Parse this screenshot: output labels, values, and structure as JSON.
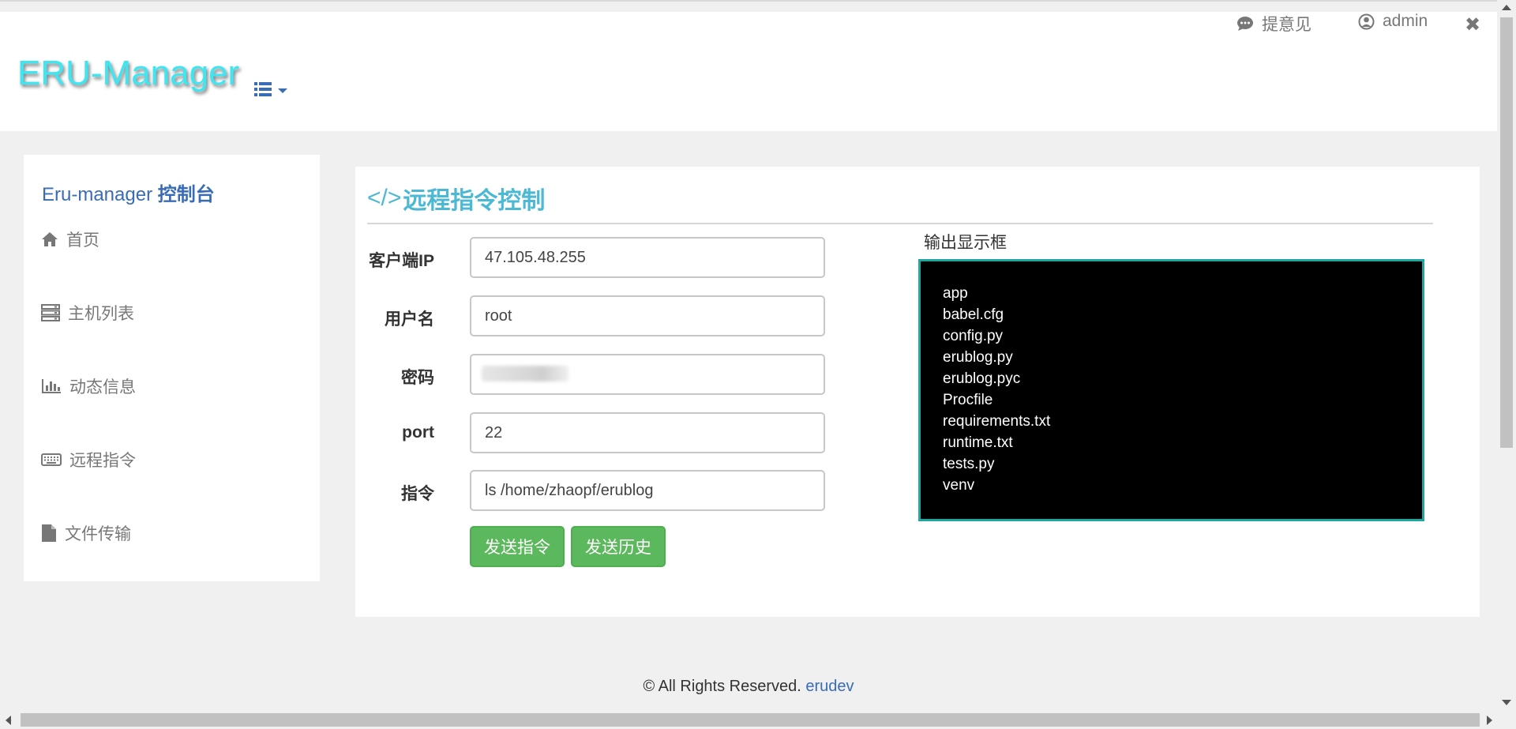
{
  "header": {
    "logo": "ERU-Manager",
    "menu_icon": "list-icon",
    "feedback_label": "提意见",
    "user_label": "admin",
    "close_glyph": "✖"
  },
  "sidebar": {
    "title_prefix": "Eru-manager ",
    "title_bold": "控制台",
    "items": [
      {
        "label": "首页",
        "icon": "home-icon"
      },
      {
        "label": "主机列表",
        "icon": "server-icon"
      },
      {
        "label": "动态信息",
        "icon": "bar-chart-icon"
      },
      {
        "label": "远程指令",
        "icon": "keyboard-icon"
      },
      {
        "label": "文件传输",
        "icon": "file-icon"
      }
    ]
  },
  "main": {
    "title": "远程指令控制",
    "title_icon": "</>",
    "form": {
      "ip_label": "客户端IP",
      "ip_value": "47.105.48.255",
      "user_label": "用户名",
      "user_value": "root",
      "password_label": "密码",
      "port_label": "port",
      "port_value": "22",
      "command_label": "指令",
      "command_value": "ls /home/zhaopf/erublog"
    },
    "buttons": {
      "send": "发送指令",
      "history": "发送历史"
    },
    "output": {
      "label": "输出显示框",
      "lines": [
        "app",
        "babel.cfg",
        "config.py",
        "erublog.py",
        "erublog.pyc",
        "Procfile",
        "requirements.txt",
        "runtime.txt",
        "tests.py",
        "venv"
      ]
    }
  },
  "footer": {
    "text": "© All Rights Reserved. ",
    "link": "erudev"
  },
  "colors": {
    "logo": "#3ee6f2",
    "title": "#4bb8d4",
    "button": "#5cb85c",
    "output_border": "#1aa8a0",
    "link": "#3a6cb5"
  }
}
